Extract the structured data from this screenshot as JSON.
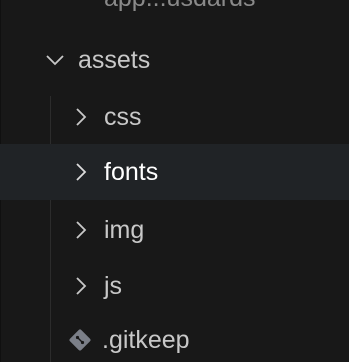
{
  "explorer": {
    "partial_item": {
      "label": "app...usdards"
    },
    "items": [
      {
        "label": "assets",
        "icon": "chevron-down-icon",
        "level": 1
      },
      {
        "label": "css",
        "icon": "chevron-right-icon",
        "level": 2
      },
      {
        "label": "fonts",
        "icon": "chevron-right-icon",
        "level": 2,
        "state": "active"
      },
      {
        "label": "img",
        "icon": "chevron-right-icon",
        "level": 2
      },
      {
        "label": "js",
        "icon": "chevron-right-icon",
        "level": 2
      },
      {
        "label": ".gitkeep",
        "icon": "git-file-icon",
        "level": 2
      }
    ],
    "colors": {
      "background": "#181818",
      "hover_row": "#202326",
      "text": "#c8c8c8",
      "active_text": "#ffffff",
      "git_icon": "#7b7f88"
    }
  }
}
